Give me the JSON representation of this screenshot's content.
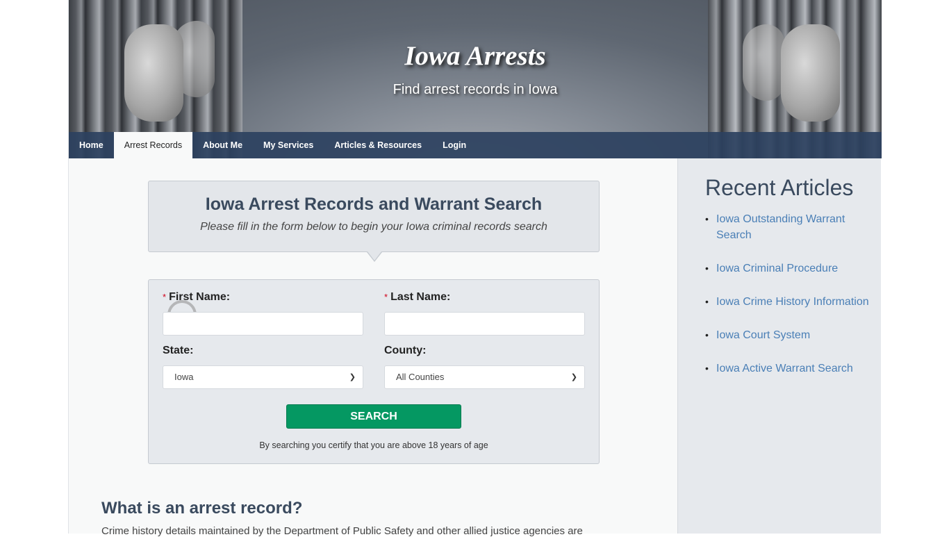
{
  "header": {
    "title": "Iowa Arrests",
    "subtitle": "Find arrest records in Iowa"
  },
  "nav": {
    "items": [
      {
        "label": "Home",
        "active": false
      },
      {
        "label": "Arrest Records",
        "active": true
      },
      {
        "label": "About Me",
        "active": false
      },
      {
        "label": "My Services",
        "active": false
      },
      {
        "label": "Articles & Resources",
        "active": false
      },
      {
        "label": "Login",
        "active": false
      }
    ]
  },
  "intro": {
    "title": "Iowa Arrest Records and Warrant Search",
    "subtitle": "Please fill in the form below to begin your Iowa criminal records search"
  },
  "form": {
    "required_marker": "*",
    "first_name_label": "First Name:",
    "first_name_value": "",
    "last_name_label": "Last Name:",
    "last_name_value": "",
    "state_label": "State:",
    "state_value": "Iowa",
    "county_label": "County:",
    "county_value": "All Counties",
    "search_label": "SEARCH",
    "certify_text": "By searching you certify that you are above 18 years of age"
  },
  "article": {
    "heading": "What is an arrest record?",
    "paragraph": "Crime history details maintained by the Department of Public Safety and other allied justice agencies are"
  },
  "sidebar": {
    "title": "Recent Articles",
    "items": [
      {
        "label": "Iowa Outstanding Warrant Search"
      },
      {
        "label": "Iowa Criminal Procedure"
      },
      {
        "label": "Iowa Crime History Information"
      },
      {
        "label": "Iowa Court System"
      },
      {
        "label": "Iowa Active Warrant Search"
      }
    ]
  },
  "colors": {
    "nav_bg": "#2c415f",
    "heading": "#3a4a5e",
    "link": "#4a7fb6",
    "search_button": "#059862",
    "required": "#d0021b"
  }
}
